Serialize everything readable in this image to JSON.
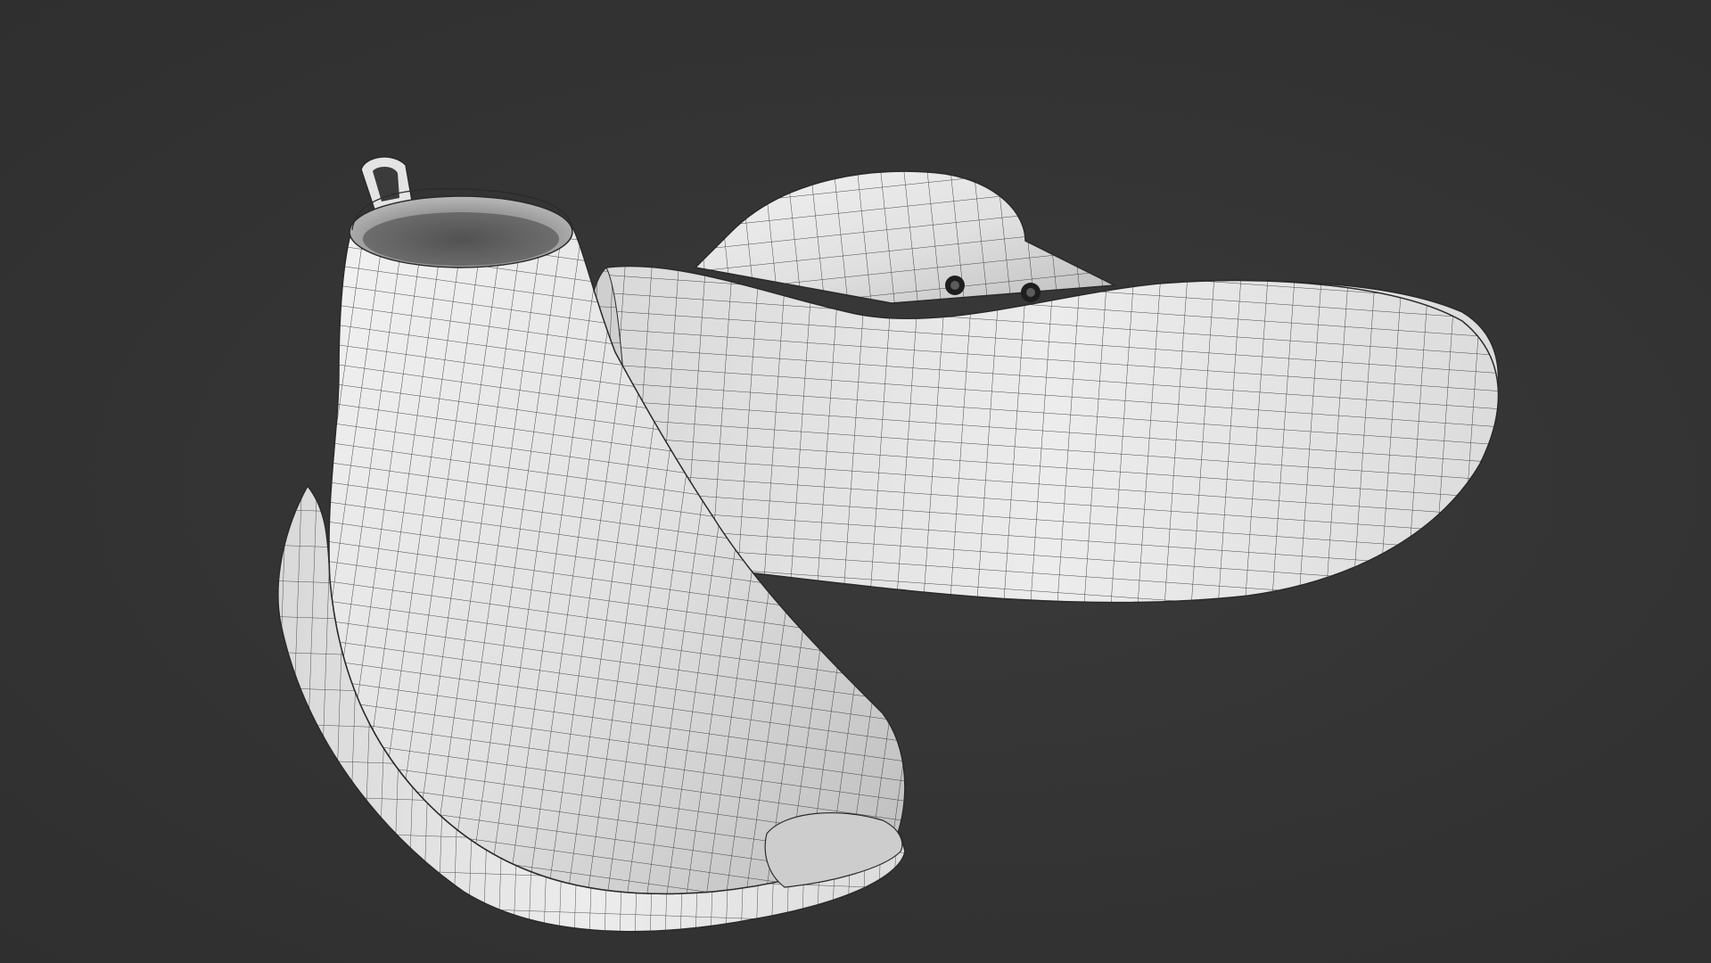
{
  "scene": {
    "background_color": "#353535",
    "mesh_color": "#dcdcdc",
    "wire_color": "#2a2a2a",
    "objects": [
      {
        "name": "boot-upright",
        "description_icon": "boot-icon"
      },
      {
        "name": "boot-lying-sole-up",
        "description_icon": "boot-icon"
      }
    ]
  }
}
